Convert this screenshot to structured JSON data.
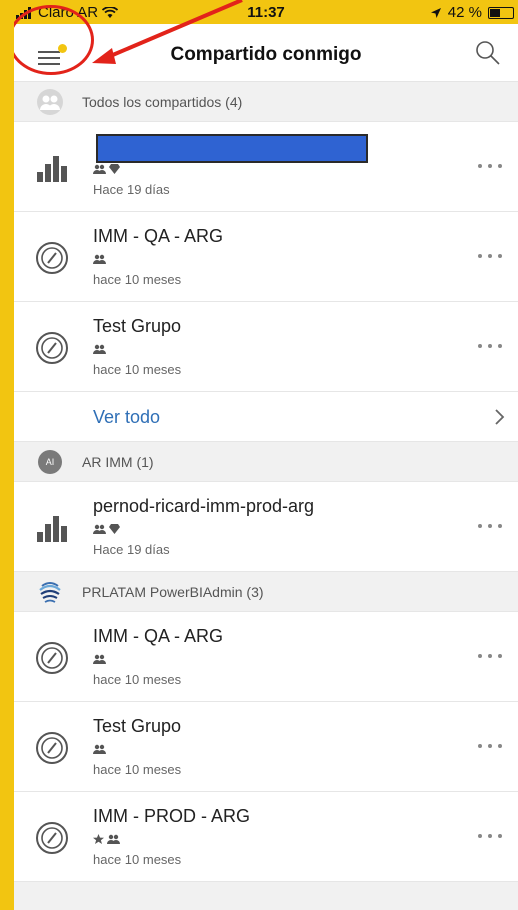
{
  "status_bar": {
    "carrier": "Claro AR",
    "time": "11:37",
    "battery": "42 %"
  },
  "nav": {
    "title": "Compartido conmigo",
    "menu_icon": "hamburger-menu-icon",
    "search_icon": "search-icon"
  },
  "sections": [
    {
      "header": "Todos los compartidos (4)",
      "avatar": "group-avatar",
      "items": [
        {
          "title": "",
          "badges": "group,premium",
          "time": "Hace 19 días",
          "icon": "report-icon",
          "redacted": true
        },
        {
          "title": "IMM - QA - ARG",
          "badges": "group",
          "time": "hace 10 meses",
          "icon": "dashboard-icon"
        },
        {
          "title": "Test Grupo",
          "badges": "group",
          "time": "hace 10 meses",
          "icon": "dashboard-icon"
        }
      ],
      "see_all": "Ver todo"
    },
    {
      "header": "AR IMM (1)",
      "avatar_text": "AI",
      "items": [
        {
          "title": "pernod-ricard-imm-prod-arg",
          "badges": "group,premium",
          "time": "Hace 19 días",
          "icon": "report-icon"
        }
      ]
    },
    {
      "header": "PRLATAM PowerBIAdmin (3)",
      "avatar": "organization-logo",
      "items": [
        {
          "title": "IMM - QA - ARG",
          "badges": "group",
          "time": "hace 10 meses",
          "icon": "dashboard-icon"
        },
        {
          "title": "Test Grupo",
          "badges": "group",
          "time": "hace 10 meses",
          "icon": "dashboard-icon"
        },
        {
          "title": "IMM - PROD - ARG",
          "badges": "favorite,group",
          "time": "hace 10 meses",
          "icon": "dashboard-icon"
        }
      ]
    }
  ],
  "colors": {
    "frame": "#f2c511",
    "link": "#2f6fb6",
    "annotation": "#e2231a",
    "redaction": "#2f63d2"
  }
}
